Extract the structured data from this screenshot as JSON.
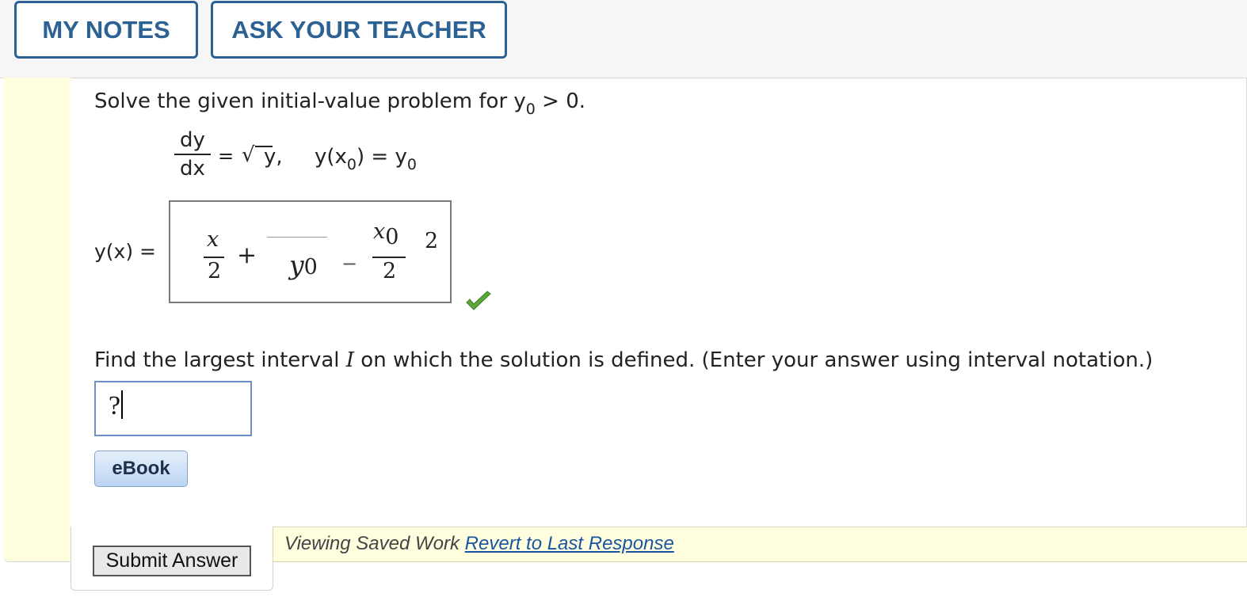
{
  "toolbar": {
    "my_notes": "MY NOTES",
    "ask_teacher": "ASK YOUR TEACHER"
  },
  "question1": {
    "text": "Solve the given initial-value problem for y",
    "text_sub": "0",
    "text_tail": " > 0.",
    "eq_dy": "dy",
    "eq_dx": "dx",
    "eq_eq": "=",
    "eq_sqrt": "√",
    "eq_y": "y,",
    "eq_cond": "y(x",
    "eq_cond_sub": "0",
    "eq_cond_tail": ") = y",
    "eq_cond_sub2": "0"
  },
  "answer1": {
    "label": "y(x) =",
    "x": "x",
    "two_a": "2",
    "plus": "+",
    "y0": "y",
    "y0_sub": "0",
    "minus": "−",
    "x0": "x",
    "x0_sub": "0",
    "two_b": "2",
    "exp": "2",
    "status": "correct"
  },
  "question2": {
    "text_a": "Find the largest interval ",
    "text_i": "I",
    "text_b": " on which the solution is defined. (Enter your answer using interval notation.)",
    "input_value": "?"
  },
  "ebook_label": "eBook",
  "submit_label": "Submit Answer",
  "saved": {
    "text": "Viewing Saved Work ",
    "link": "Revert to Last Response"
  },
  "colors": {
    "accent": "#2b6193",
    "check": "#5aa93a",
    "highlight": "#ffffe0"
  }
}
